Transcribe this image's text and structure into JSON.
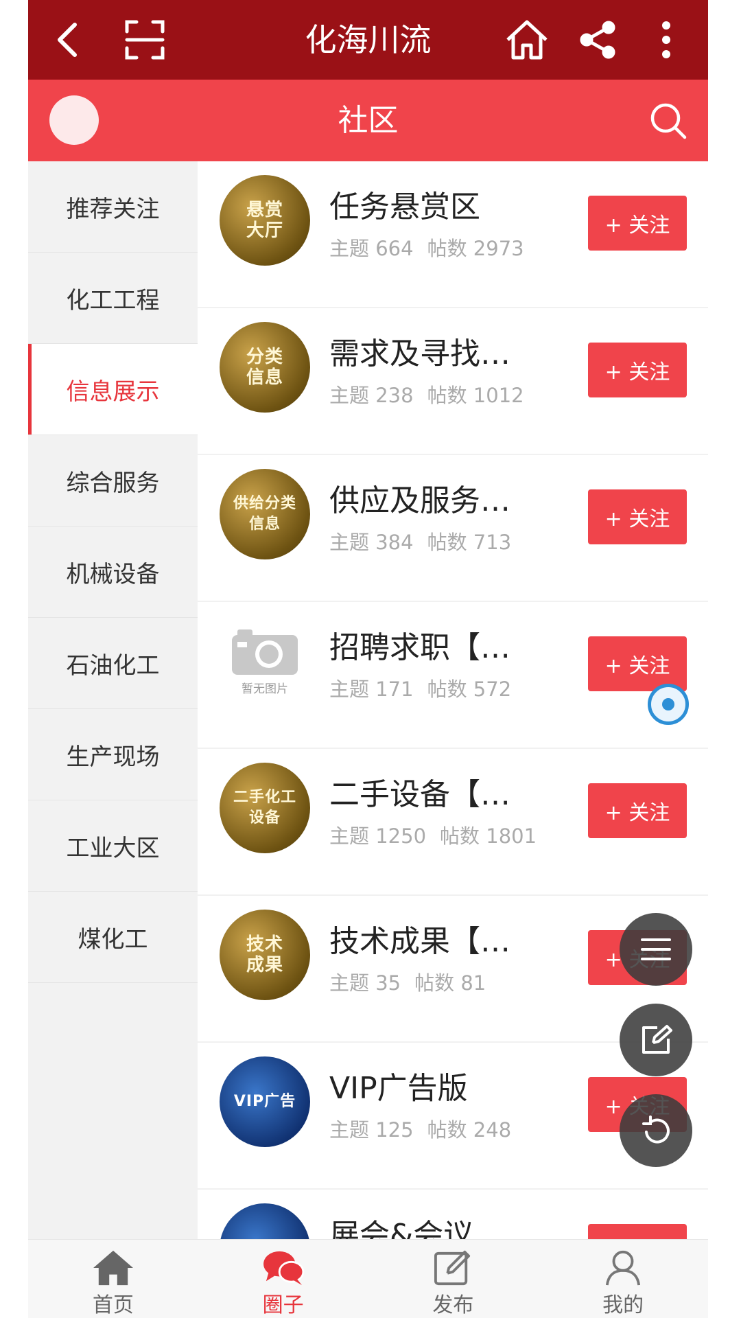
{
  "topbar": {
    "title": "化海川流",
    "icons": [
      "back-icon",
      "scan-icon",
      "home-icon",
      "share-icon",
      "more-icon"
    ]
  },
  "subbar": {
    "title": "社区",
    "icons": [
      "search-icon"
    ]
  },
  "sidebar": {
    "items": [
      {
        "label": "推荐关注",
        "active": false
      },
      {
        "label": "化工工程",
        "active": false
      },
      {
        "label": "信息展示",
        "active": true
      },
      {
        "label": "综合服务",
        "active": false
      },
      {
        "label": "机械设备",
        "active": false
      },
      {
        "label": "石油化工",
        "active": false
      },
      {
        "label": "生产现场",
        "active": false
      },
      {
        "label": "工业大区",
        "active": false
      },
      {
        "label": "煤化工",
        "active": false
      }
    ]
  },
  "forums": [
    {
      "name": "任务悬赏区",
      "topics": "主题 664",
      "posts": "帖数 2973",
      "thumb_text": [
        "悬赏",
        "大厅"
      ],
      "follow": "+ 关注"
    },
    {
      "name": "需求及寻找…",
      "topics": "主题 238",
      "posts": "帖数 1012",
      "thumb_text": [
        "分类",
        "信息"
      ],
      "follow": "+ 关注"
    },
    {
      "name": "供应及服务…",
      "topics": "主题 384",
      "posts": "帖数 713",
      "thumb_text": [
        "供给分类",
        "信息"
      ],
      "follow": "+ 关注"
    },
    {
      "name": "招聘求职【…",
      "topics": "主题 171",
      "posts": "帖数 572",
      "thumb_caption": "暂无图片",
      "follow": "+ 关注"
    },
    {
      "name": "二手设备【…",
      "topics": "主题 1250",
      "posts": "帖数 1801",
      "thumb_text": [
        "二手化工",
        "设备"
      ],
      "follow": "+ 关注"
    },
    {
      "name": "技术成果【…",
      "topics": "主题 35",
      "posts": "帖数 81",
      "thumb_text": [
        "技术",
        "成果"
      ],
      "follow": "+ 关注"
    },
    {
      "name": "VIP广告版",
      "topics": "主题 125",
      "posts": "帖数 248",
      "thumb_text": [
        "VIP广告"
      ],
      "follow": "+ 关注"
    },
    {
      "name": "展会&会议",
      "topics": "",
      "posts": "",
      "thumb_text": [
        ""
      ],
      "follow": ""
    }
  ],
  "fabs": [
    "menu-icon",
    "edit-icon",
    "refresh-icon"
  ],
  "tabbar": {
    "tabs": [
      {
        "label": "首页",
        "icon": "home-icon",
        "active": false
      },
      {
        "label": "圈子",
        "icon": "chat-bubbles-icon",
        "active": true
      },
      {
        "label": "发布",
        "icon": "compose-icon",
        "active": false
      },
      {
        "label": "我的",
        "icon": "user-icon",
        "active": false
      }
    ]
  },
  "colors": {
    "dark_red": "#9a1116",
    "red": "#f0444b",
    "accent": "#e7353c"
  }
}
